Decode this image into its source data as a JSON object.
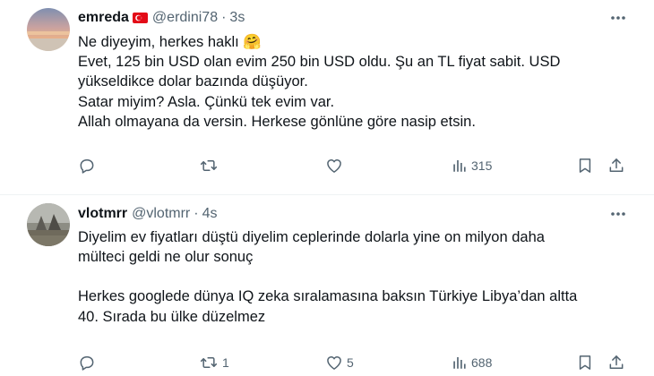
{
  "tweets": [
    {
      "display_name": "emreda",
      "handle": "@erdini78",
      "separator": "·",
      "time": "3s",
      "lines": [
        "Ne diyeyim, herkes haklı 🤗",
        "Evet, 125 bin USD olan evim 250 bin USD oldu. Şu an TL fiyat sabit. USD",
        "yükseldikce dolar bazında düşüyor.",
        "Satar miyim? Asla. Çünkü tek evim var.",
        "Allah olmayana da versin. Herkese gönlüne göre nasip etsin."
      ],
      "replies": "",
      "retweets": "",
      "likes": "",
      "views": "315",
      "icons": [
        "more-icon",
        "reply-icon",
        "retweet-icon",
        "like-icon",
        "views-icon",
        "bookmark-icon",
        "share-icon"
      ]
    },
    {
      "display_name": "vlotmrr",
      "handle": "@vlotmrr",
      "separator": "·",
      "time": "4s",
      "lines": [
        "Diyelim ev fiyatları düştü diyelim ceplerinde dolarla yine on milyon daha",
        "mülteci geldi ne olur sonuç",
        "",
        "Herkes googlede dünya IQ zeka sıralamasına baksın Türkiye Libya’dan altta",
        "40. Sırada bu ülke düzelmez"
      ],
      "replies": "",
      "retweets": "1",
      "likes": "5",
      "views": "688"
    }
  ],
  "colors": {
    "text": "#0f1419",
    "secondary": "#536471",
    "divider": "#eff3f4",
    "flag": "#e30a17"
  }
}
